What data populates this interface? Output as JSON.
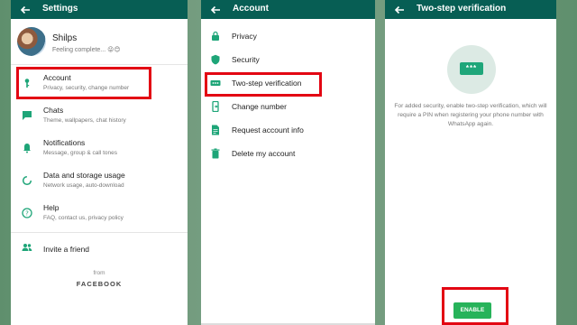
{
  "settings": {
    "title": "Settings",
    "profile": {
      "name": "Shilps",
      "status": "Feeling complete... 😜😊"
    },
    "items": [
      {
        "label": "Account",
        "sub": "Privacy, security, change number",
        "icon": "key-icon"
      },
      {
        "label": "Chats",
        "sub": "Theme, wallpapers, chat history",
        "icon": "chat-icon"
      },
      {
        "label": "Notifications",
        "sub": "Message, group & call tones",
        "icon": "bell-icon"
      },
      {
        "label": "Data and storage usage",
        "sub": "Network usage, auto-download",
        "icon": "data-usage-icon"
      },
      {
        "label": "Help",
        "sub": "FAQ, contact us, privacy policy",
        "icon": "help-icon"
      }
    ],
    "invite": "Invite a friend",
    "from": "from",
    "brand": "FACEBOOK"
  },
  "account": {
    "title": "Account",
    "items": [
      {
        "label": "Privacy",
        "icon": "lock-icon"
      },
      {
        "label": "Security",
        "icon": "shield-icon"
      },
      {
        "label": "Two-step verification",
        "icon": "dots-icon"
      },
      {
        "label": "Change number",
        "icon": "phone-icon"
      },
      {
        "label": "Request account info",
        "icon": "document-icon"
      },
      {
        "label": "Delete my account",
        "icon": "trash-icon"
      }
    ]
  },
  "twostep": {
    "title": "Two-step verification",
    "pin_mask": "***",
    "description": "For added security, enable two-step verification, which will require a PIN when registering your phone number with WhatsApp again.",
    "enable_label": "ENABLE"
  },
  "colors": {
    "appbar": "#075e54",
    "accent": "#25d366",
    "highlight": "#e30613"
  }
}
